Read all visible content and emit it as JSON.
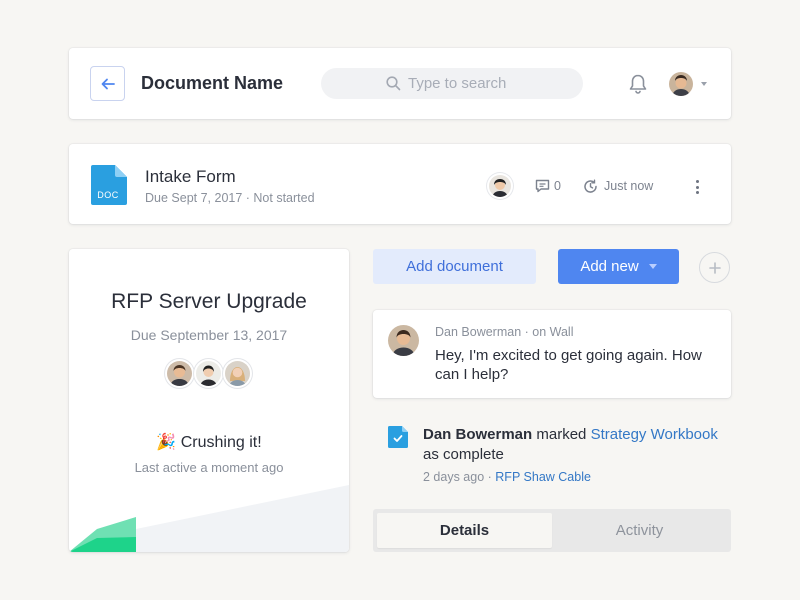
{
  "header": {
    "back_icon": "arrow-left-icon",
    "title": "Document Name",
    "search_placeholder": "Type to search",
    "search_icon": "search-icon",
    "bell_icon": "bell-icon"
  },
  "intake": {
    "doc_icon_label": "DOC",
    "title": "Intake Form",
    "meta": "Due Sept 7, 2017 · Not started",
    "comment_count": "0",
    "time": "Just now"
  },
  "project": {
    "title": "RFP Server Upgrade",
    "due": "Due September 13, 2017",
    "status_emoji": "🎉",
    "status": "Crushing it!",
    "last_active": "Last active a moment ago"
  },
  "actions": {
    "add_document": "Add document",
    "add_new": "Add new"
  },
  "message": {
    "author": "Dan Bowerman",
    "location": " · on Wall",
    "text": "Hey, I'm excited to get going again. How can I help?"
  },
  "activity": {
    "actor": "Dan Bowerman",
    "verb": " marked ",
    "target": "Strategy Workbook",
    "suffix": " as complete",
    "when": "2 days ago",
    "sep": " · ",
    "project": "RFP Shaw Cable"
  },
  "tabs": [
    {
      "label": "Details",
      "active": true
    },
    {
      "label": "Activity",
      "active": false
    }
  ],
  "colors": {
    "accent": "#4f86f0",
    "link": "#3478c6",
    "doc_icon": "#2a9fe0",
    "green": "#1ed38a"
  }
}
